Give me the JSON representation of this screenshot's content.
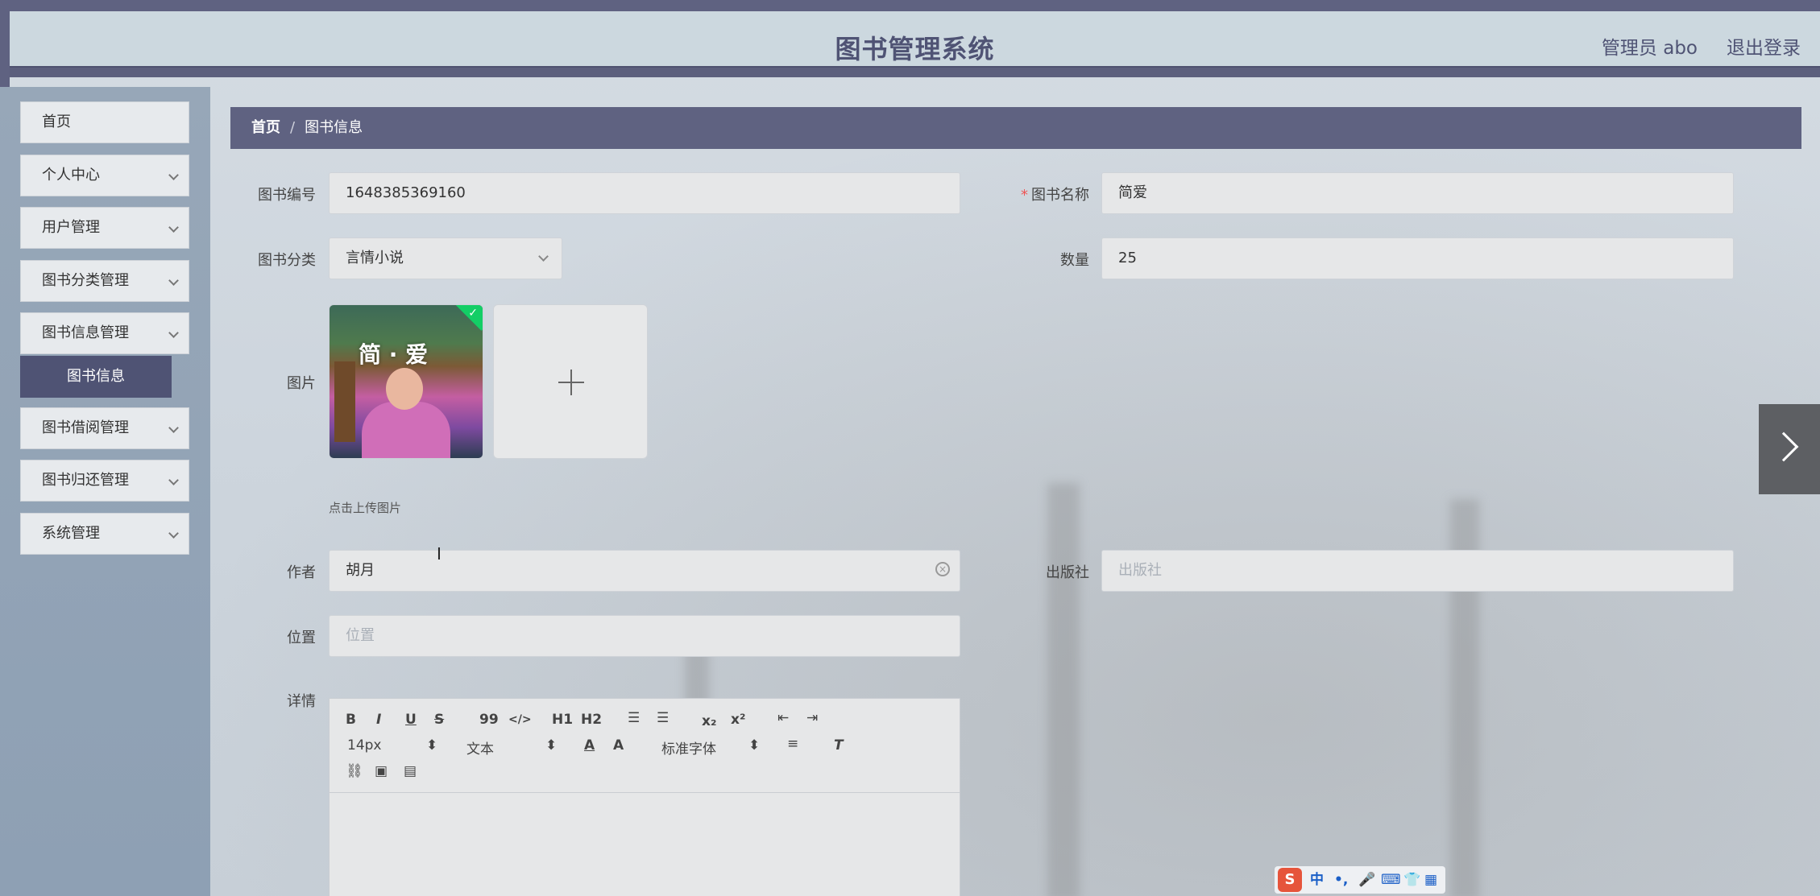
{
  "header": {
    "title": "图书管理系统",
    "user_label": "管理员 abo",
    "logout_label": "退出登录"
  },
  "sidebar": {
    "items": [
      {
        "label": "首页",
        "has_chevron": false
      },
      {
        "label": "个人中心",
        "has_chevron": true
      },
      {
        "label": "用户管理",
        "has_chevron": true
      },
      {
        "label": "图书分类管理",
        "has_chevron": true
      },
      {
        "label": "图书信息管理",
        "has_chevron": true
      },
      {
        "label": "图书借阅管理",
        "has_chevron": true
      },
      {
        "label": "图书归还管理",
        "has_chevron": true
      },
      {
        "label": "系统管理",
        "has_chevron": true
      }
    ],
    "active_sub_item": "图书信息"
  },
  "breadcrumb": {
    "home": "首页",
    "separator": "/",
    "current": "图书信息"
  },
  "form": {
    "book_no_label": "图书编号",
    "book_no_value": "1648385369160",
    "book_name_label": "图书名称",
    "book_name_required": "*",
    "book_name_value": "简爱",
    "category_label": "图书分类",
    "category_value": "言情小说",
    "quantity_label": "数量",
    "quantity_value": "25",
    "image_label": "图片",
    "image_cover_title": "简 · 爱",
    "upload_tip": "点击上传图片",
    "author_label": "作者",
    "author_value": "胡月",
    "publisher_label": "出版社",
    "publisher_placeholder": "出版社",
    "location_label": "位置",
    "location_placeholder": "位置",
    "details_label": "详情"
  },
  "editor": {
    "font_size": "14px",
    "heading": "文本",
    "font_family": "标准字体",
    "buttons": [
      "B",
      "I",
      "U",
      "S",
      "99",
      "</>",
      "H1",
      "H2",
      "ordered-list",
      "bullet-list",
      "x₂",
      "x²",
      "outdent",
      "indent"
    ]
  },
  "ime": {
    "logo": "S",
    "lang": "中"
  },
  "colors": {
    "accent": "#5f6281",
    "header_bg": "#ccd8df",
    "sidebar_bg": "#97a7b8",
    "active_menu": "#4f5374",
    "upload_success": "#13ce66"
  }
}
